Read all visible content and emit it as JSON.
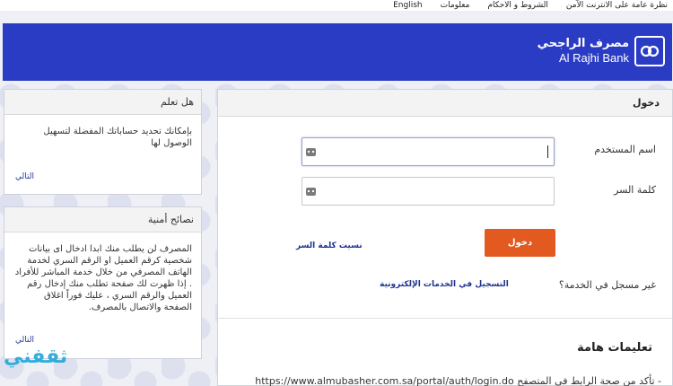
{
  "topnav": {
    "items": [
      "نظرة عامة على الانترنت الآمن",
      "الشروط و الاحكام",
      "معلومات",
      "English"
    ]
  },
  "brand": {
    "name_ar": "مصرف الراجحي",
    "name_en": "Al Rajhi Bank"
  },
  "sidebar": {
    "did_you_know": {
      "title": "هل تعلم",
      "text": "بإمكانك تحديد حساباتك المفضلة لتسهيل الوصول لها",
      "next": "التالي"
    },
    "security_tips": {
      "title": "نصائح أمنية",
      "text": "المصرف لن يطلب منك ابدا ادخال اى بيانات شخصية كرقم العميل او الرقم السري لخدمة الهاتف المصرفي من خلال خدمة المباشر للأفراد . إذا ظهرت لك صفحة تطلب منك إدخال رقم العميل والرقم السري ، عليك فوراً اغلاق الصفحة والاتصال بالمصرف.",
      "next": "التالي"
    }
  },
  "login": {
    "title": "دخول",
    "username_label": "اسم المستخدم",
    "username_value": "",
    "password_label": "كلمة السر",
    "password_value": "",
    "submit": "دخول",
    "forgot": "نسيت كلمة السر",
    "not_registered": "غير مسجل في الخدمة؟",
    "register": "التسجيل في الخدمات الإلكترونية"
  },
  "notes": {
    "title": "تعليمات هامة",
    "line1": "- تأكد من صحة الرابط في المتصفح https://www.almubasher.com.sa/portal/auth/login.do"
  },
  "watermark": "ثقفني",
  "colors": {
    "banner": "#2b3cc4",
    "accent": "#e35a20",
    "link": "#1d3491"
  }
}
